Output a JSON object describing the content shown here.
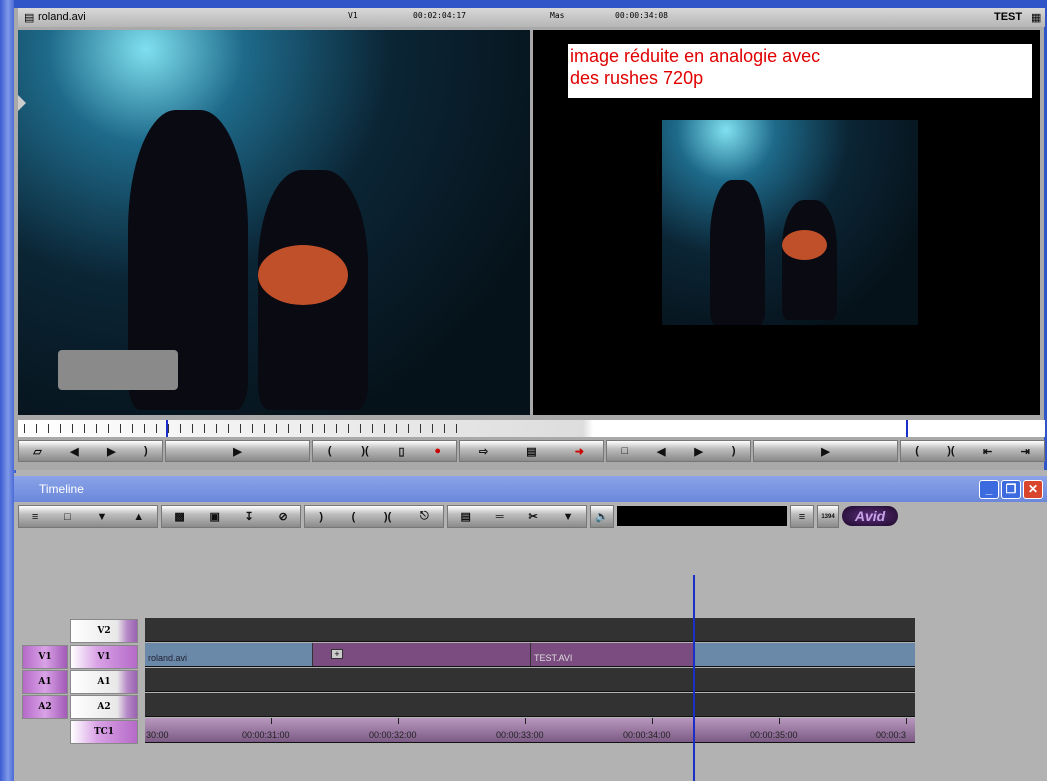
{
  "monitor": {
    "clip_name": "roland.avi",
    "track": "V1",
    "source_timecode": "00:02:04:17",
    "mode": "Mas",
    "record_timecode": "00:00:34:08",
    "sequence_name": "TEST",
    "overlay_note_line1": "image réduite en analogie avec",
    "overlay_note_line2": "des rushes 720p"
  },
  "timeline": {
    "title": "Timeline",
    "logo": "Avid",
    "badge_1394": "1394",
    "tracks": {
      "v2": "V2",
      "v1": "V1",
      "a1": "A1",
      "a2": "A2",
      "tc": "TC1"
    },
    "source_tracks": {
      "v1": "V1",
      "a1": "A1",
      "a2": "A2"
    },
    "clips": {
      "clip1": "roland.avi",
      "clip2": "TEST.AVI"
    },
    "timecodes": [
      "30:00",
      "00:00:31:00",
      "00:00:32:00",
      "00:00:33:00",
      "00:00:34:00",
      "00:00:35:00",
      "00:00:3"
    ]
  },
  "colors": {
    "accent": "#2f55c8",
    "clip_blue": "#6a88a8",
    "clip_purple": "#7a4c80",
    "overlay_text": "#e00000"
  }
}
